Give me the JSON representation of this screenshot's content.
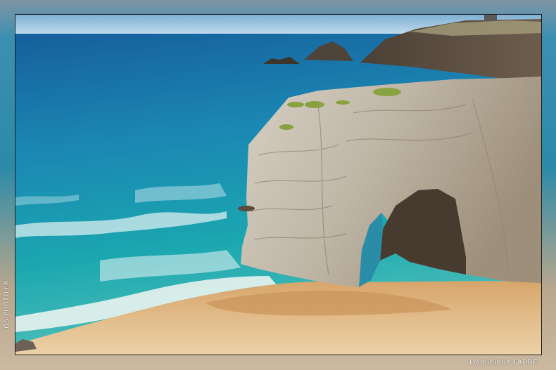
{
  "image": {
    "subject": "sea-arch-on-sandy-beach",
    "watermark_credit": "Dominique FABRE",
    "watermark_site": "LOS-PHOTO.FR"
  },
  "palette": {
    "sky": "#8fb8d6",
    "sea_deep": "#1e6fa8",
    "sea_turquoise": "#1aa3b0",
    "sand": "#d9b27e",
    "rock": "#c9c2b4",
    "frame": "#bdb4a6"
  }
}
